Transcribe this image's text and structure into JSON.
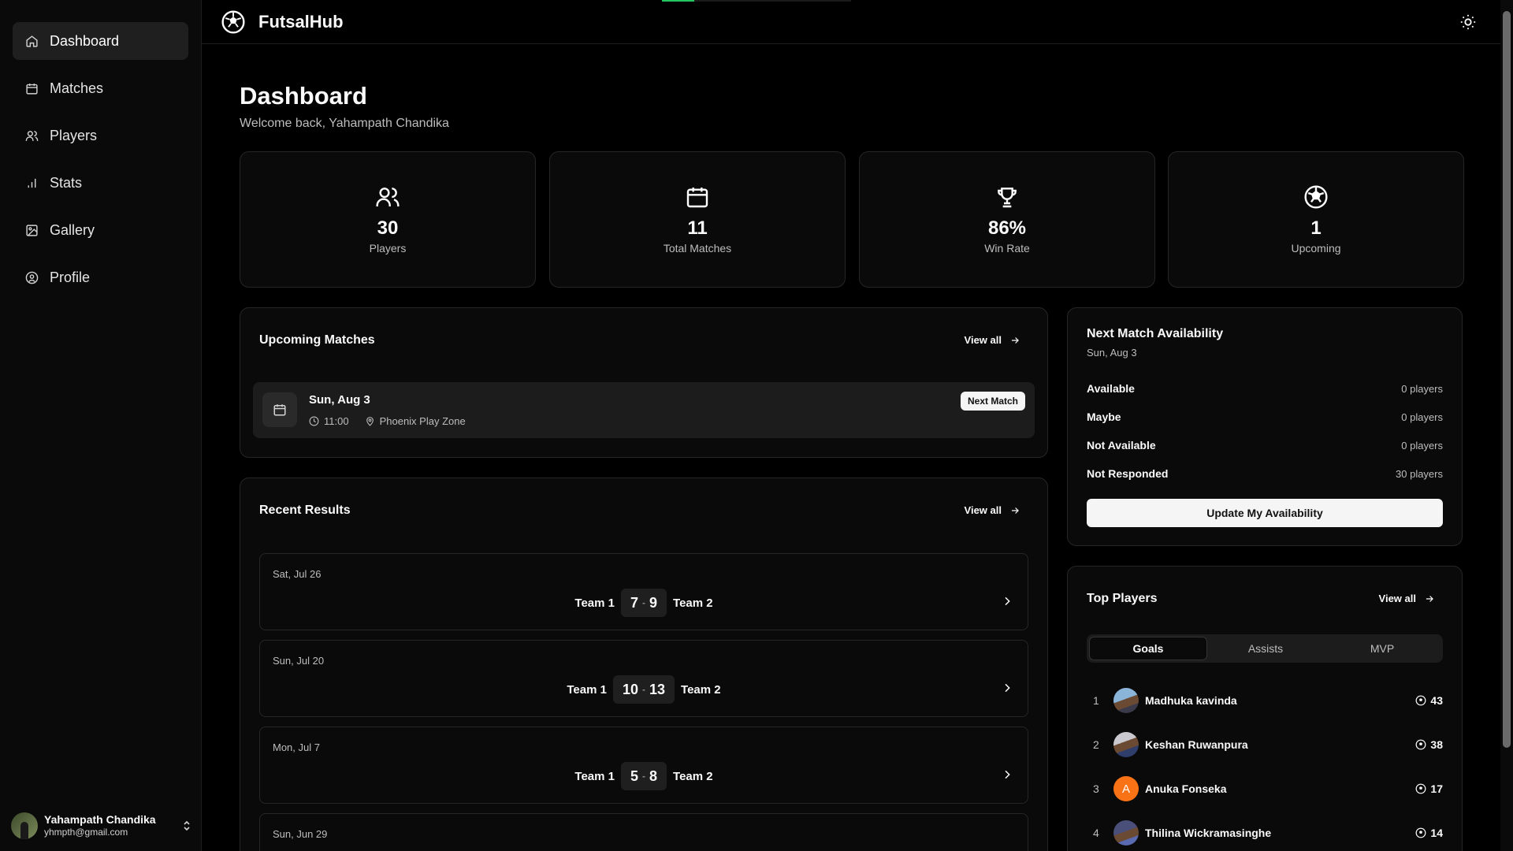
{
  "app": {
    "brand": "FutsalHub"
  },
  "sidebar": {
    "items": [
      {
        "label": "Dashboard",
        "icon": "home-icon",
        "active": true
      },
      {
        "label": "Matches",
        "icon": "calendar-icon"
      },
      {
        "label": "Players",
        "icon": "users-icon"
      },
      {
        "label": "Stats",
        "icon": "bar-chart-icon"
      },
      {
        "label": "Gallery",
        "icon": "image-icon"
      },
      {
        "label": "Profile",
        "icon": "user-circle-icon"
      }
    ],
    "user": {
      "name": "Yahampath Chandika",
      "email": "yhmpth@gmail.com"
    }
  },
  "page": {
    "title": "Dashboard",
    "subtitle": "Welcome back, Yahampath Chandika"
  },
  "stats": [
    {
      "value": "30",
      "label": "Players",
      "icon": "users-icon"
    },
    {
      "value": "11",
      "label": "Total Matches",
      "icon": "calendar-icon"
    },
    {
      "value": "86%",
      "label": "Win Rate",
      "icon": "trophy-icon"
    },
    {
      "value": "1",
      "label": "Upcoming",
      "icon": "soccer-ball-icon"
    }
  ],
  "upcoming": {
    "title": "Upcoming Matches",
    "view_all": "View all",
    "match": {
      "date": "Sun, Aug 3",
      "time": "11:00",
      "venue": "Phoenix Play Zone",
      "badge": "Next Match"
    }
  },
  "recent": {
    "title": "Recent Results",
    "view_all": "View all",
    "results": [
      {
        "date": "Sat, Jul 26",
        "home": "Team 1",
        "home_score": "7",
        "away_score": "9",
        "away": "Team 2"
      },
      {
        "date": "Sun, Jul 20",
        "home": "Team 1",
        "home_score": "10",
        "away_score": "13",
        "away": "Team 2"
      },
      {
        "date": "Mon, Jul 7",
        "home": "Team 1",
        "home_score": "5",
        "away_score": "8",
        "away": "Team 2"
      },
      {
        "date": "Sun, Jun 29"
      }
    ]
  },
  "availability": {
    "title": "Next Match Availability",
    "date": "Sun, Aug 3",
    "rows": [
      {
        "label": "Available",
        "value": "0 players"
      },
      {
        "label": "Maybe",
        "value": "0 players"
      },
      {
        "label": "Not Available",
        "value": "0 players"
      },
      {
        "label": "Not Responded",
        "value": "30 players"
      }
    ],
    "button": "Update My Availability"
  },
  "top_players": {
    "title": "Top Players",
    "view_all": "View all",
    "tabs": [
      "Goals",
      "Assists",
      "MVP"
    ],
    "active_tab": "Goals",
    "players": [
      {
        "rank": "1",
        "name": "Madhuka kavinda",
        "goals": "43"
      },
      {
        "rank": "2",
        "name": "Keshan Ruwanpura",
        "goals": "38"
      },
      {
        "rank": "3",
        "name": "Anuka Fonseka",
        "goals": "17",
        "initial": "A"
      },
      {
        "rank": "4",
        "name": "Thilina Wickramasinghe",
        "goals": "14"
      }
    ]
  },
  "colors": {
    "accent_green": "#22c55e",
    "avatar_orange": "#f97316"
  },
  "loading_progress": 0.17
}
